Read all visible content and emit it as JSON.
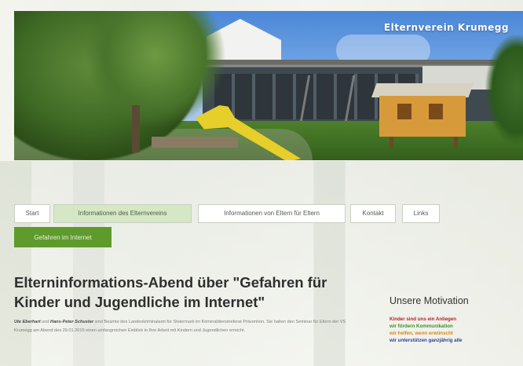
{
  "header": {
    "site_title": "Elternverein Krumegg"
  },
  "nav": {
    "items": [
      {
        "label": "Start"
      },
      {
        "label": "Informationen des Elternvereins"
      },
      {
        "label": "Informationen von Eltern für Eltern"
      },
      {
        "label": "Kontakt"
      },
      {
        "label": "Links"
      },
      {
        "label": "Gefahren im Internet"
      }
    ]
  },
  "article": {
    "title": "Elterninformations-Abend über \"Gefahren für Kinder und Jugendliche im Internet\"",
    "author1": "Ute Eberhart",
    "connector": " und ",
    "author2": "Hans-Peter Schuster",
    "body": " sind Beamte des Landeskriminalamt für Steiermark im Kriminaldienstreferat Prävention. Sie halten den Seminar für Eltern der VS Krumegg am Abend des 29.01.2015 einen umfangreichen Einblick in Ihre Arbeit mit Kindern und Jugendlichen erreicht."
  },
  "sidebar": {
    "title": "Unsere Motivation",
    "lines": [
      {
        "text": "Kinder sind uns ein Anliegen",
        "color": "#b0242a"
      },
      {
        "text": "wir fördern Kommunikation",
        "color": "#3f8f2a"
      },
      {
        "text": "wir helfen, wenn erwünscht",
        "color": "#d9861b"
      },
      {
        "text": "wir unterstützen ganzjährig alle",
        "color": "#2b3f9a"
      }
    ]
  },
  "colors": {
    "accent_green": "#5e9a2c",
    "active_tab": "#d6e7c6"
  }
}
